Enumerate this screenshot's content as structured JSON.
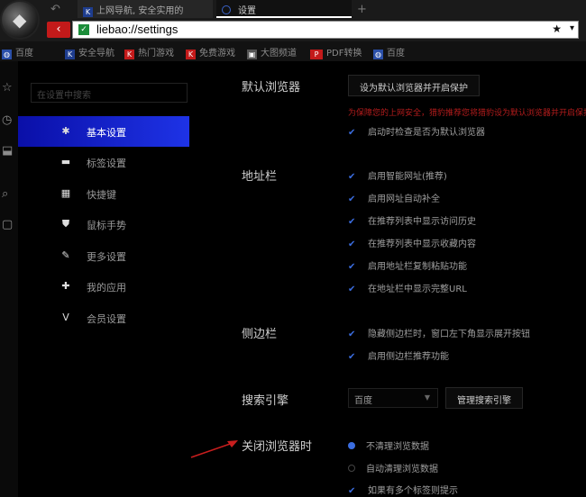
{
  "tabs": [
    {
      "label": "上网导航, 安全实用的",
      "favicon": "K"
    },
    {
      "label": "设置"
    }
  ],
  "address_bar": {
    "url": "liebao://settings"
  },
  "bookmarks": [
    {
      "label": "百度",
      "icon": "globe-icon",
      "color": "#3b6de0"
    },
    {
      "label": "安全导航",
      "icon": "K",
      "color": "#1e3d8f"
    },
    {
      "label": "热门游戏",
      "icon": "K",
      "color": "#c31a1a"
    },
    {
      "label": "免费游戏",
      "icon": "K",
      "color": "#c31a1a"
    },
    {
      "label": "大图频道",
      "icon": "image-icon",
      "color": "#555"
    },
    {
      "label": "PDF转换",
      "icon": "pdf",
      "color": "#c31a1a"
    },
    {
      "label": "百度",
      "icon": "globe-icon",
      "color": "#3b6de0"
    }
  ],
  "settings": {
    "search_placeholder": "在设置中搜索",
    "nav": [
      {
        "label": "基本设置",
        "icon": "gear-icon",
        "glyph": "✱",
        "active": true
      },
      {
        "label": "标签设置",
        "icon": "tab-icon",
        "glyph": "▬",
        "active": false
      },
      {
        "label": "快捷键",
        "icon": "keyboard-icon",
        "glyph": "▦",
        "active": false
      },
      {
        "label": "鼠标手势",
        "icon": "mouse-icon",
        "glyph": "⛊",
        "active": false
      },
      {
        "label": "更多设置",
        "icon": "wrench-icon",
        "glyph": "✎",
        "active": false
      },
      {
        "label": "我的应用",
        "icon": "puzzle-icon",
        "glyph": "✚",
        "active": false
      },
      {
        "label": "会员设置",
        "icon": "vip-icon",
        "glyph": "V",
        "active": false
      }
    ],
    "default_browser": {
      "title": "默认浏览器",
      "button": "设为默认浏览器并开启保护",
      "warning": "为保障您的上网安全，猎豹推荐您将猎豹设为默认浏览器并开启保护",
      "checkbox": "启动时检查是否为默认浏览器"
    },
    "address_bar": {
      "title": "地址栏",
      "options": [
        "启用智能网址(推荐)",
        "启用网址自动补全",
        "在推荐列表中显示访问历史",
        "在推荐列表中显示收藏内容",
        "启用地址栏复制粘贴功能",
        "在地址栏中显示完整URL"
      ]
    },
    "sidebar": {
      "title": "侧边栏",
      "options": [
        "隐藏侧边栏时，窗口左下角显示展开按钮",
        "启用侧边栏推荐功能"
      ]
    },
    "search_engine": {
      "title": "搜索引擎",
      "selected": "百度",
      "manage_button": "管理搜索引擎"
    },
    "on_close": {
      "title": "关闭浏览器时",
      "radios": [
        {
          "label": "不清理浏览数据",
          "checked": true
        },
        {
          "label": "自动清理浏览数据",
          "checked": false
        }
      ],
      "checkbox": "如果有多个标签则提示"
    }
  },
  "colors": {
    "accent": "#3b6de0",
    "nav_active": "#1e33e6",
    "warning": "#b41c1c",
    "back_button": "#c31a1a"
  }
}
